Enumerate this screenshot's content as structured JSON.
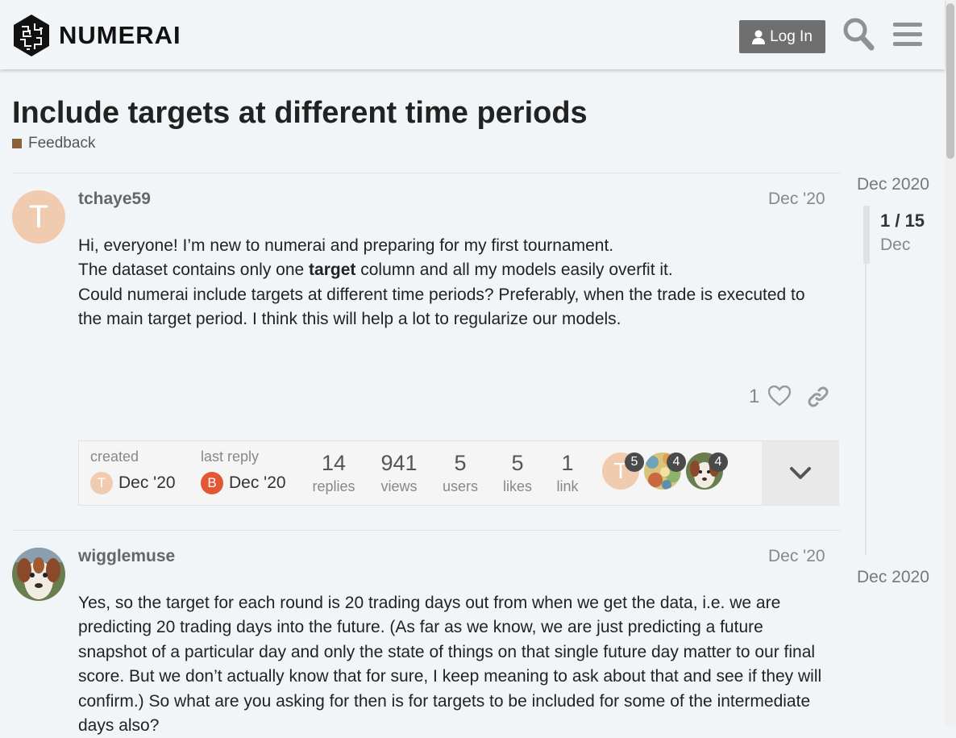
{
  "header": {
    "logo_text": "NUMERAI",
    "login_label": "Log In",
    "icons": [
      "logo-icon",
      "user-icon",
      "search-icon",
      "menu-icon"
    ]
  },
  "topic": {
    "title": "Include targets at different time periods",
    "category": "Feedback",
    "category_color": "#8c6238"
  },
  "posts": [
    {
      "username": "tchaye59",
      "avatar_letter": "T",
      "avatar_color": "#f0cbb0",
      "date": "Dec '20",
      "body": {
        "line1": "Hi, everyone! I’m new to numerai and preparing for my first tournament.",
        "line2_before": "The dataset contains only one ",
        "line2_bold": "target",
        "line2_after": " column and all my models easily overfit it.",
        "line3": "Could numerai include targets at different time periods? Preferably, when the trade is executed to the main target period. I think this will help a lot to regularize our models."
      },
      "likes": "1"
    },
    {
      "username": "wigglemuse",
      "date": "Dec '20",
      "body": "Yes, so the target for each round is 20 trading days out from when we get the data, i.e. we are predicting 20 trading days into the future. (As far as we know, we are just predicting a future snapshot of a particular day and only the state of things on that single future day matter to our final score. But we don’t actually know that for sure, I keep meaning to ask about that and see if they will confirm.) So what are you asking for then is for targets to be included for some of the intermediate days also?"
    }
  ],
  "topic_map": {
    "created_label": "created",
    "created_date": "Dec '20",
    "created_letter": "T",
    "last_reply_label": "last reply",
    "last_reply_date": "Dec '20",
    "last_reply_letter": "B",
    "last_reply_color": "#e45735",
    "stats": [
      {
        "num": "14",
        "label": "replies"
      },
      {
        "num": "941",
        "label": "views"
      },
      {
        "num": "5",
        "label": "users"
      },
      {
        "num": "5",
        "label": "likes"
      },
      {
        "num": "1",
        "label": "link"
      }
    ],
    "participants": [
      {
        "letter": "T",
        "count": "5"
      },
      {
        "count": "4"
      },
      {
        "count": "4"
      }
    ]
  },
  "timeline": {
    "start_date": "Dec 2020",
    "position": "1 / 15",
    "position_date": "Dec",
    "end_date": "Dec 2020"
  }
}
